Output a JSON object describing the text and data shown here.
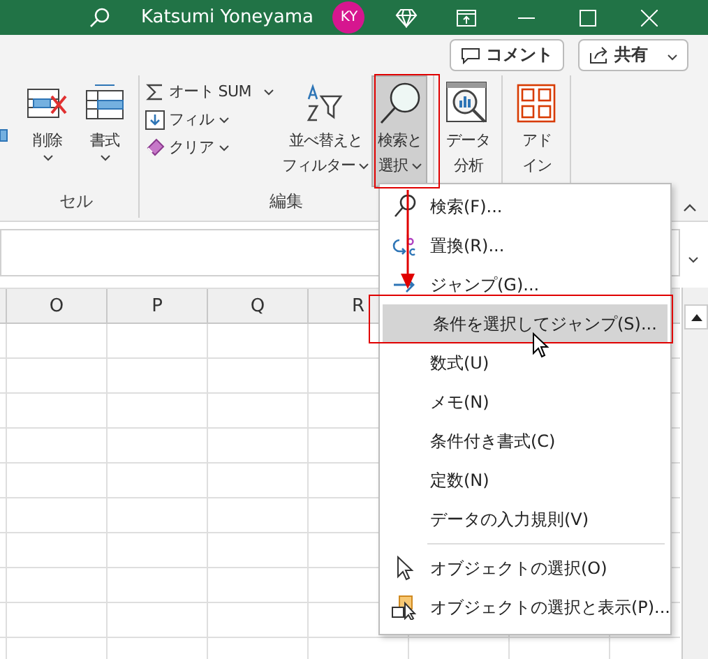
{
  "title_bar": {
    "user": "Katsumi Yoneyama",
    "avatar": "KY"
  },
  "top_buttons": [
    {
      "kind": "comment",
      "label": "コメント"
    },
    {
      "kind": "share",
      "label": "共有"
    }
  ],
  "ribbon_groups": [
    {
      "title": "セル",
      "buttons": [
        {
          "kind": "delete",
          "lines": [
            "削除"
          ],
          "selected": false
        },
        {
          "kind": "format",
          "lines": [
            "書式"
          ],
          "selected": false
        }
      ]
    },
    {
      "title": "編集",
      "small_buttons": [
        {
          "kind": "autosum",
          "label": "オート SUM"
        },
        {
          "kind": "fill",
          "label": "フィル"
        },
        {
          "kind": "clear",
          "label": "クリア"
        }
      ],
      "buttons": [
        {
          "kind": "sort",
          "lines": [
            "並べ替えと",
            "フィルター"
          ],
          "selected": false
        },
        {
          "kind": "find",
          "lines": [
            "検索と",
            "選択"
          ],
          "selected": true
        }
      ]
    },
    {
      "buttons": [
        {
          "kind": "analyze",
          "lines": [
            "データ",
            "分析"
          ],
          "selected": false
        }
      ]
    },
    {
      "buttons": [
        {
          "kind": "addin",
          "lines": [
            "アド",
            "イン"
          ],
          "selected": false
        }
      ]
    }
  ],
  "columns": [
    "O",
    "P",
    "Q",
    "R"
  ],
  "menu": {
    "items": [
      {
        "kind": "search",
        "label": "検索(F)...",
        "selected": false
      },
      {
        "kind": "replace",
        "label": "置換(R)...",
        "selected": false
      },
      {
        "kind": "jump",
        "label": "ジャンプ(G)...",
        "selected": false
      },
      {
        "kind": "plain",
        "label": "条件を選択してジャンプ(S)...",
        "selected": true
      },
      {
        "kind": "plain",
        "label": "数式(U)",
        "selected": false
      },
      {
        "kind": "plain",
        "label": "メモ(N)",
        "selected": false
      },
      {
        "kind": "plain",
        "label": "条件付き書式(C)",
        "selected": false
      },
      {
        "kind": "plain",
        "label": "定数(N)",
        "selected": false
      },
      {
        "kind": "plain",
        "label": "データの入力規則(V)",
        "selected": false
      },
      {
        "kind": "separator"
      },
      {
        "kind": "pointer",
        "label": "オブジェクトの選択(O)",
        "selected": false
      },
      {
        "kind": "pane",
        "label": "オブジェクトの選択と表示(P)...",
        "selected": false
      }
    ]
  }
}
